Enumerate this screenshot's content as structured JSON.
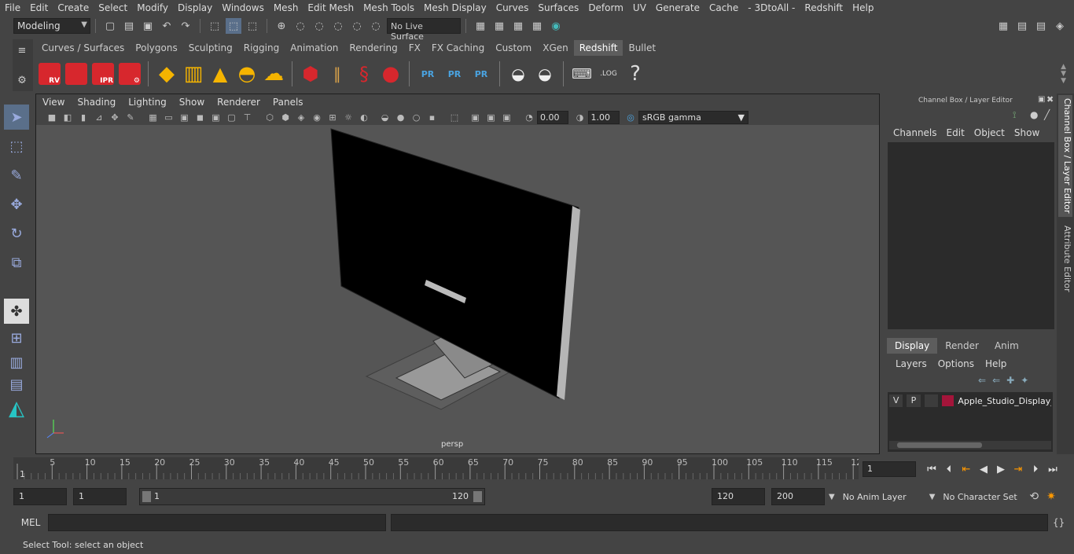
{
  "menubar": {
    "items": [
      "File",
      "Edit",
      "Create",
      "Select",
      "Modify",
      "Display",
      "Windows",
      "Mesh",
      "Edit Mesh",
      "Mesh Tools",
      "Mesh Display",
      "Curves",
      "Surfaces",
      "Deform",
      "UV",
      "Generate",
      "Cache",
      "- 3DtoAll -",
      "Redshift",
      "Help"
    ]
  },
  "statusline": {
    "mode": "Modeling",
    "live_surface": "No Live Surface"
  },
  "shelf": {
    "tabs": [
      "Curves / Surfaces",
      "Polygons",
      "Sculpting",
      "Rigging",
      "Animation",
      "Rendering",
      "FX",
      "FX Caching",
      "Custom",
      "XGen",
      "Redshift",
      "Bullet"
    ],
    "active_tab": "Redshift",
    "cube_labels": [
      "RV",
      "",
      "IPR",
      ""
    ],
    "pr_label": "PR",
    "log_label": ".LOG",
    "help_glyph": "?"
  },
  "viewport": {
    "menu": [
      "View",
      "Shading",
      "Lighting",
      "Show",
      "Renderer",
      "Panels"
    ],
    "exposure": "0.00",
    "gamma_value": "1.00",
    "color_space": "sRGB gamma",
    "camera_label": "persp"
  },
  "right_panel": {
    "title": "Channel Box / Layer Editor",
    "menu": [
      "Channels",
      "Edit",
      "Object",
      "Show"
    ],
    "layer_tabs": [
      "Display",
      "Render",
      "Anim"
    ],
    "active_layer_tab": "Display",
    "layer_menu": [
      "Layers",
      "Options",
      "Help"
    ],
    "layer": {
      "v": "V",
      "p": "P",
      "name": "Apple_Studio_Display_",
      "color": "#a4153a"
    }
  },
  "side_tabs": [
    "Channel Box / Layer Editor",
    "Attribute Editor"
  ],
  "timeline": {
    "ticks": [
      "5",
      "10",
      "15",
      "20",
      "25",
      "30",
      "35",
      "40",
      "45",
      "50",
      "55",
      "60",
      "65",
      "70",
      "75",
      "80",
      "85",
      "90",
      "95",
      "100",
      "105",
      "110",
      "115",
      "12"
    ],
    "start_label": "1",
    "current_frame": "1"
  },
  "range": {
    "start": "1",
    "start2": "1",
    "slider_start": "1",
    "slider_end": "120",
    "end": "120",
    "end2": "200",
    "anim_layer": "No Anim Layer",
    "character_set": "No Character Set"
  },
  "mel": {
    "label": "MEL"
  },
  "helpline": "Select Tool: select an object"
}
